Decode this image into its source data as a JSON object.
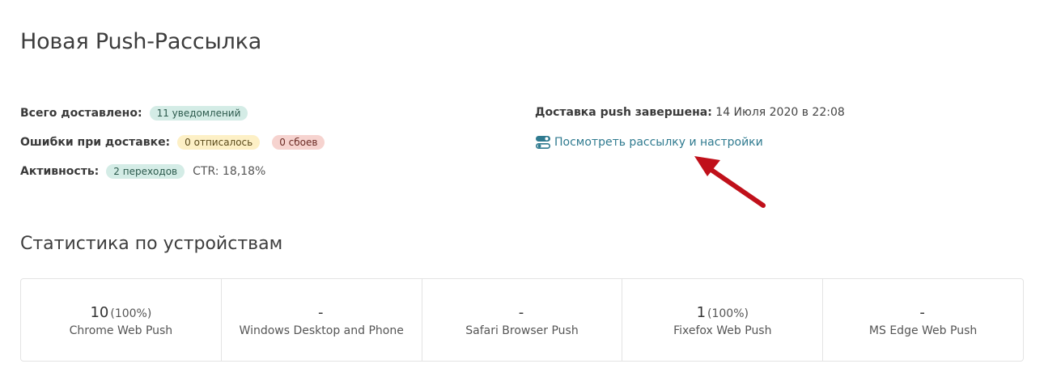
{
  "page": {
    "title": "Новая Push-Рассылка"
  },
  "stats": {
    "delivered_label": "Всего доставлено:",
    "delivered_badge": "11 уведомлений",
    "errors_label": "Ошибки при доставке:",
    "unsubscribed_badge": "0 отписалось",
    "failures_badge": "0 сбоев",
    "activity_label": "Активность:",
    "clicks_badge": "2 переходов",
    "ctr_text": "CTR: 18,18%"
  },
  "delivery": {
    "label": "Доставка push завершена:",
    "value": "14 Июля 2020 в 22:08",
    "view_link": "Посмотреть рассылку и настройки",
    "view_link_icon": "toggle-settings-icon"
  },
  "devices": {
    "section_title": "Статистика по устройствам",
    "items": [
      {
        "count": "10",
        "percent": "(100%)",
        "name": "Chrome Web Push"
      },
      {
        "count": "-",
        "percent": "",
        "name": "Windows Desktop and Phone"
      },
      {
        "count": "-",
        "percent": "",
        "name": "Safari Browser Push"
      },
      {
        "count": "1",
        "percent": "(100%)",
        "name": "Fixefox Web Push"
      },
      {
        "count": "-",
        "percent": "",
        "name": "MS Edge Web Push"
      }
    ]
  },
  "colors": {
    "link": "#2f7a8f",
    "badge_green": "#d4ece6",
    "badge_yellow": "#fdf0c6",
    "badge_red": "#f6d3cf",
    "arrow": "#c0101a"
  }
}
